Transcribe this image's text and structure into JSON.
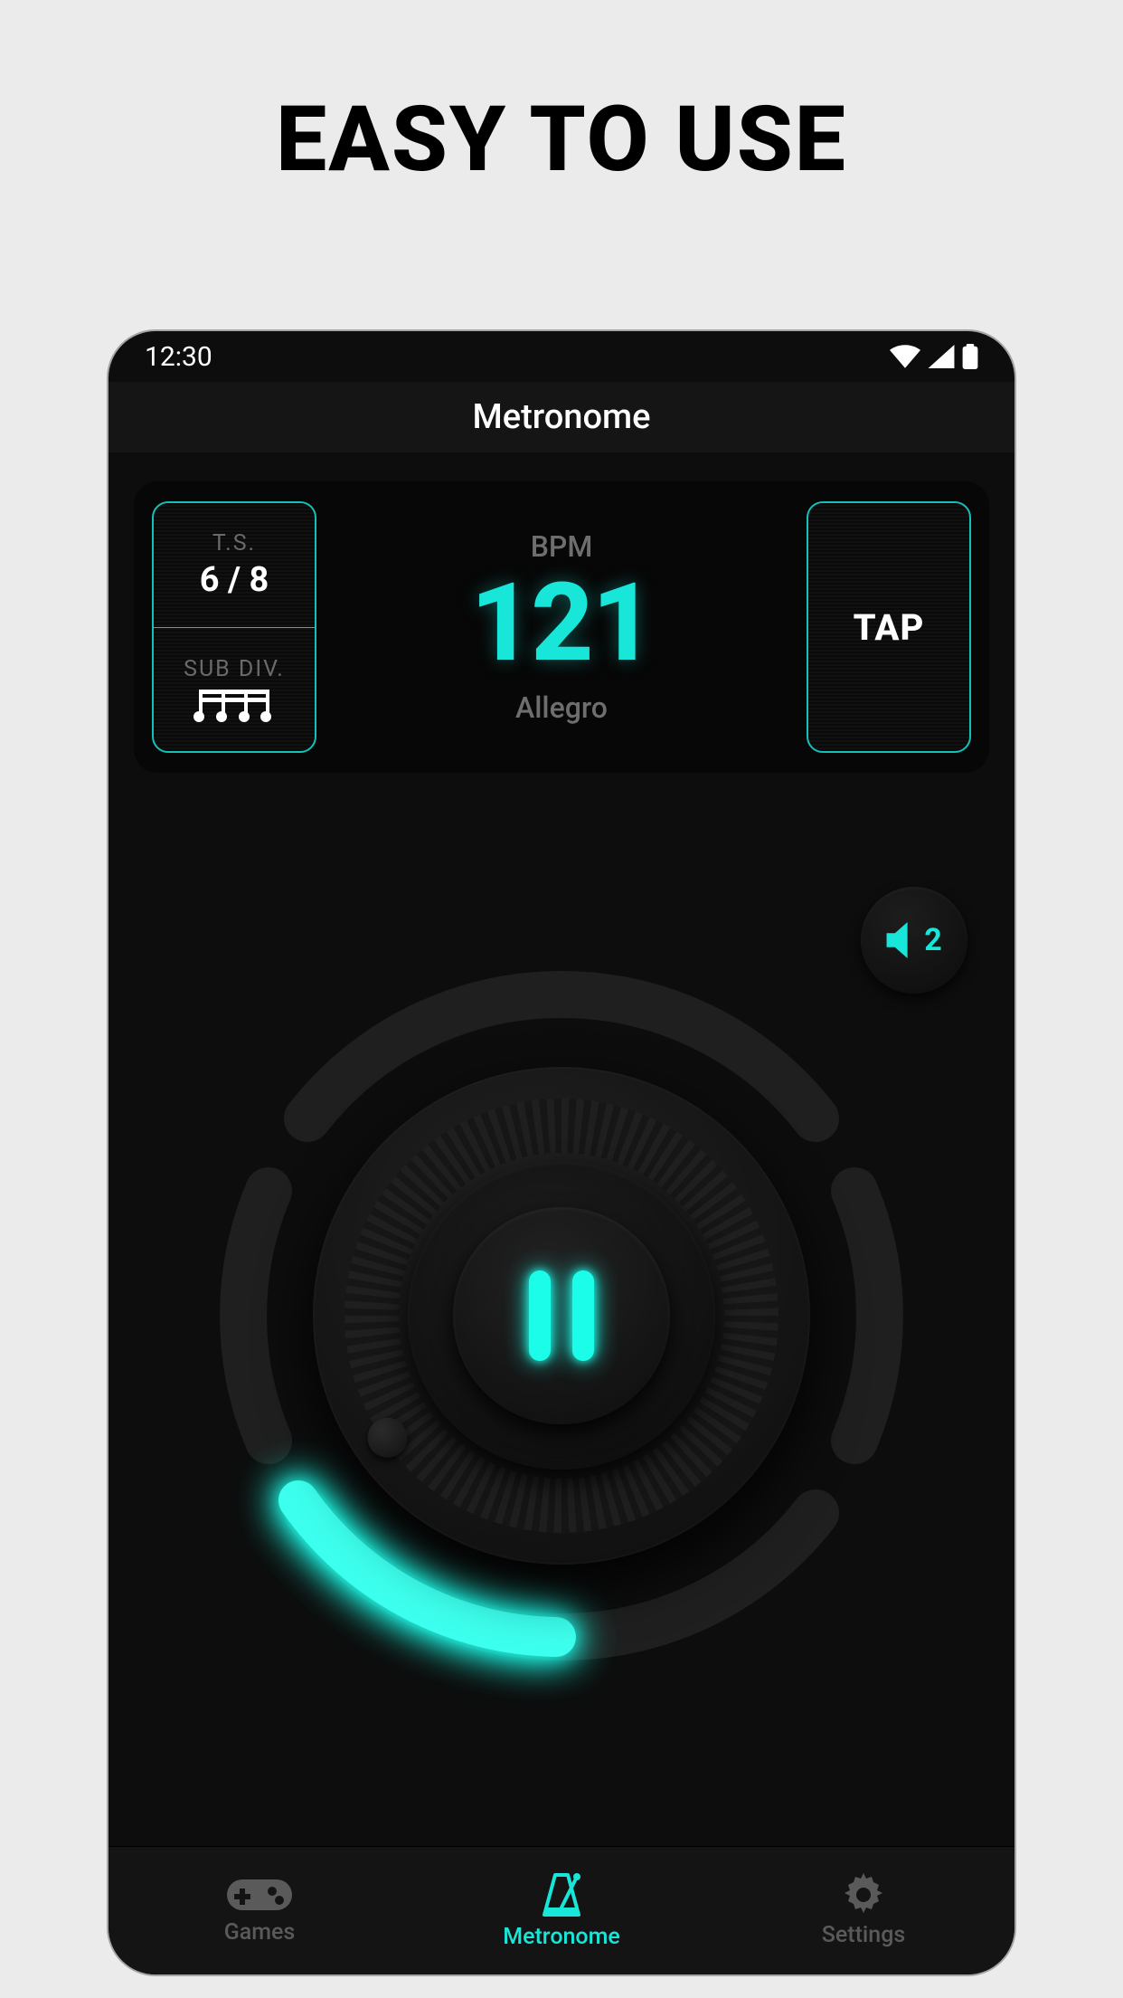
{
  "headline": "EASY TO USE",
  "status": {
    "time": "12:30"
  },
  "header": {
    "title": "Metronome"
  },
  "panel": {
    "ts_label": "T.S.",
    "ts_value": "6 / 8",
    "subdiv_label": "SUB DIV.",
    "bpm_label": "BPM",
    "bpm_value": "121",
    "tempo_name": "Allegro",
    "tap_label": "TAP"
  },
  "volume": {
    "level": "2"
  },
  "colors": {
    "accent": "#17e6d8"
  },
  "nav": {
    "items": [
      {
        "label": "Games",
        "active": false
      },
      {
        "label": "Metronome",
        "active": true
      },
      {
        "label": "Settings",
        "active": false
      }
    ]
  }
}
